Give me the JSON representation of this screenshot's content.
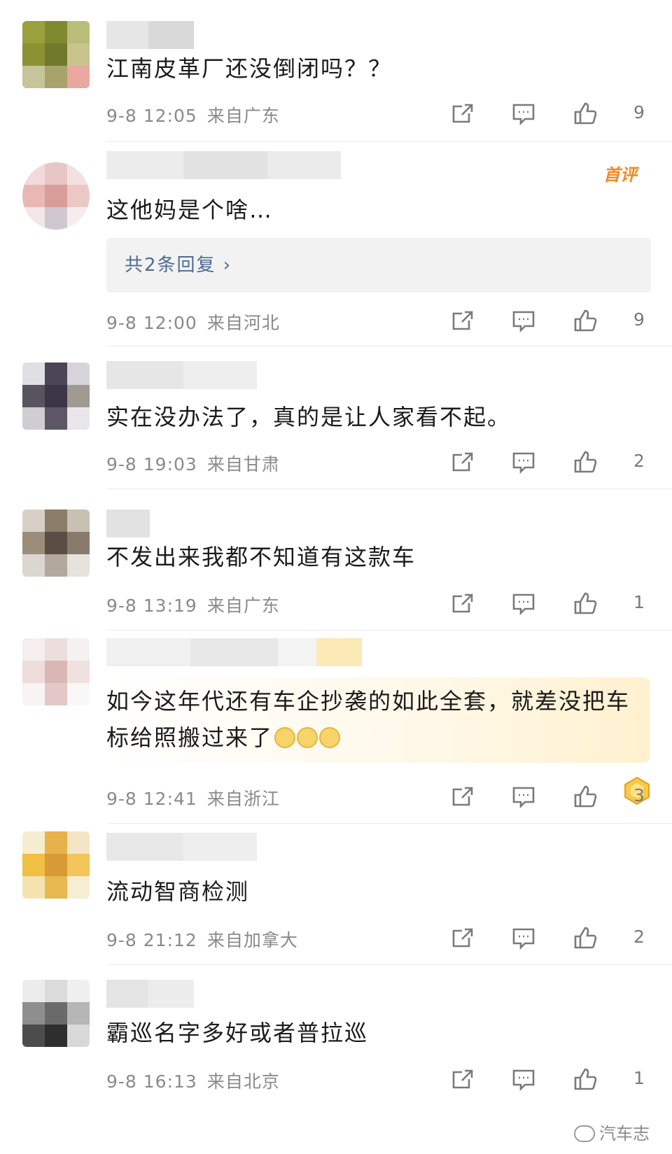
{
  "icons": {
    "share": "share-icon",
    "comment": "comment-icon",
    "like": "like-icon"
  },
  "colors": {
    "meta": "#8a8a8a",
    "reply_link": "#4d6b94",
    "first_comment_badge": "#f08a24",
    "divider": "#ececec"
  },
  "comments": [
    {
      "text": "江南皮革厂还没倒闭吗？？",
      "time": "9-8 12:05",
      "location": "来自广东",
      "likes": "9"
    },
    {
      "text": "这他妈是个啥…",
      "time": "9-8 12:00",
      "location": "来自河北",
      "likes": "9",
      "badge": "首评",
      "replies_label": "共2条回复 ›"
    },
    {
      "text": "实在没办法了，真的是让人家看不起。",
      "time": "9-8 19:03",
      "location": "来自甘肃",
      "likes": "2"
    },
    {
      "text": "不发出来我都不知道有这款车",
      "time": "9-8 13:19",
      "location": "来自广东",
      "likes": "1"
    },
    {
      "text": "如今这年代还有车企抄袭的如此全套，就差没把车标给照搬过来了",
      "time": "9-8 12:41",
      "location": "来自浙江",
      "likes": "3"
    },
    {
      "text": "流动智商检测",
      "time": "9-8 21:12",
      "location": "来自加拿大",
      "likes": "2"
    },
    {
      "text": "霸巡名字多好或者普拉巡",
      "time": "9-8 16:13",
      "location": "来自北京",
      "likes": "1"
    }
  ],
  "watermark": "汽车志"
}
